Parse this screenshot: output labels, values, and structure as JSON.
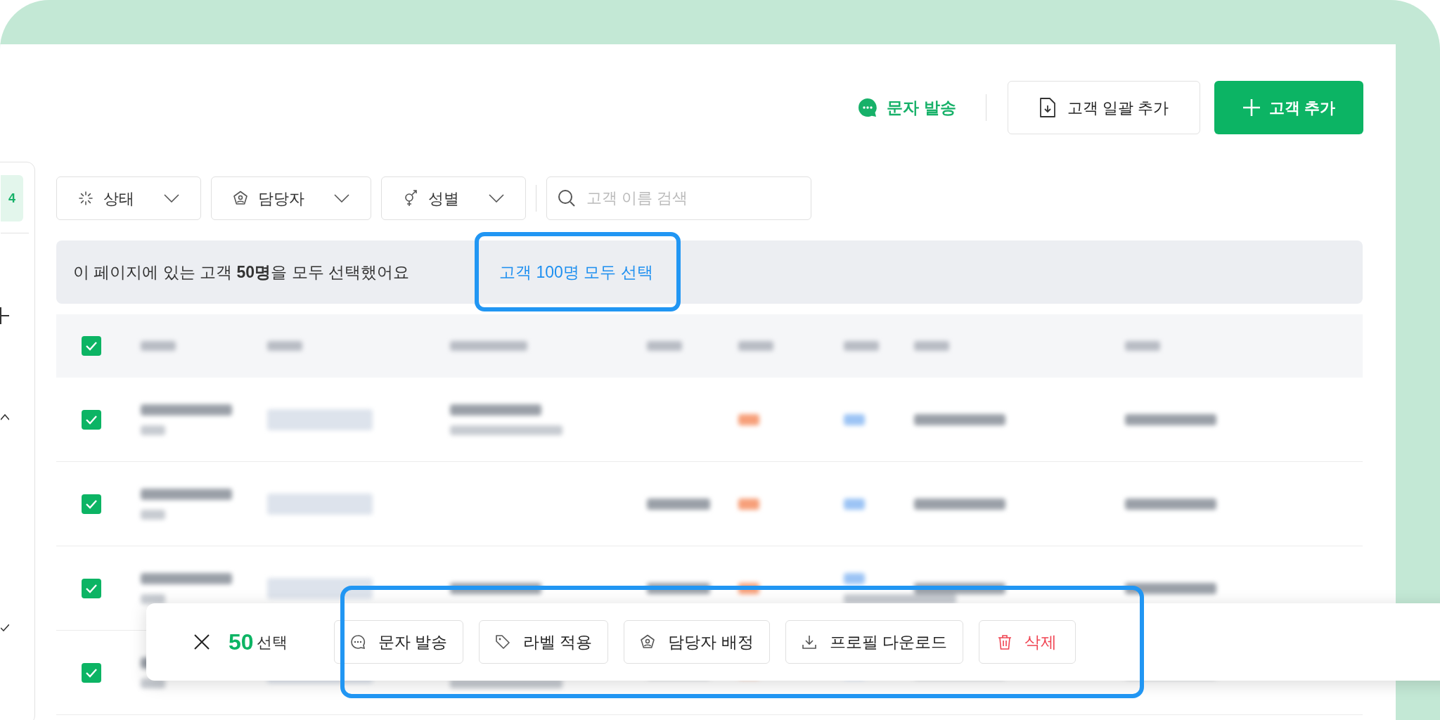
{
  "header_actions": {
    "sms": "문자 발송",
    "bulk_add": "고객 일괄 추가",
    "add": "고객 추가"
  },
  "sidebar": {
    "badge": "4"
  },
  "filters": [
    {
      "kind": "status",
      "label": "상태"
    },
    {
      "kind": "manager",
      "label": "담당자"
    },
    {
      "kind": "gender",
      "label": "성별"
    }
  ],
  "search": {
    "placeholder": "고객 이름 검색"
  },
  "banner": {
    "message": "이 페이지에 있는 고객 **50명**을 모두 선택했어요",
    "link": "고객 100명 모두 선택",
    "highlighted": true
  },
  "table": {
    "header_checked": true,
    "rows": [
      {
        "checked": true
      },
      {
        "checked": true
      },
      {
        "checked": true
      },
      {
        "checked": true
      }
    ]
  },
  "selection_bar": {
    "count": "50",
    "label": "선택",
    "highlighted": true,
    "actions": [
      {
        "kind": "sms",
        "label": "문자 발송"
      },
      {
        "kind": "label",
        "label": "라벨 적용"
      },
      {
        "kind": "manager",
        "label": "담당자 배정"
      },
      {
        "kind": "download",
        "label": "프로필 다운로드"
      },
      {
        "kind": "delete",
        "label": "삭제"
      }
    ]
  }
}
